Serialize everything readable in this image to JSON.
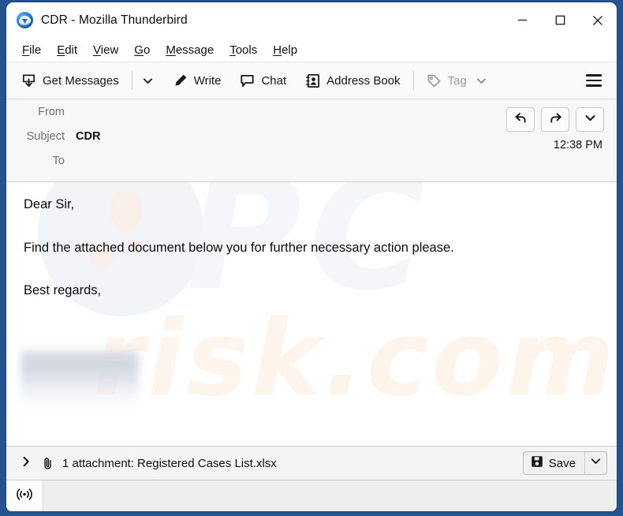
{
  "window": {
    "title": "CDR - Mozilla Thunderbird",
    "app_icon": "thunderbird-icon",
    "controls": {
      "minimize": "minimize-icon",
      "maximize": "maximize-icon",
      "close": "close-icon"
    }
  },
  "menubar": {
    "items": [
      {
        "label": "File",
        "accel": "F"
      },
      {
        "label": "Edit",
        "accel": "E"
      },
      {
        "label": "View",
        "accel": "V"
      },
      {
        "label": "Go",
        "accel": "G"
      },
      {
        "label": "Message",
        "accel": "M"
      },
      {
        "label": "Tools",
        "accel": "T"
      },
      {
        "label": "Help",
        "accel": "H"
      }
    ]
  },
  "toolbar": {
    "get_messages_label": "Get Messages",
    "get_messages_icon": "inbox-download-icon",
    "get_messages_caret": "chevron-down-icon",
    "write_label": "Write",
    "write_icon": "pencil-icon",
    "chat_label": "Chat",
    "chat_icon": "speech-bubble-icon",
    "address_book_label": "Address Book",
    "address_book_icon": "address-book-icon",
    "tag_label": "Tag",
    "tag_icon": "tag-icon",
    "tag_caret": "chevron-down-icon",
    "tag_disabled": true,
    "app_menu_icon": "hamburger-menu-icon"
  },
  "message_header": {
    "from_label": "From",
    "from_value": "",
    "subject_label": "Subject",
    "subject_value": "CDR",
    "to_label": "To",
    "to_value": "",
    "time": "12:38 PM",
    "actions": {
      "reply": "reply-arrow-icon",
      "forward": "forward-arrow-icon",
      "more": "chevron-down-icon"
    }
  },
  "message_body": {
    "lines": [
      "Dear Sir,",
      "Find the attached document below you for further necessary action please.",
      "Best regards,"
    ],
    "signature_redacted": true,
    "watermark_primary": "PC",
    "watermark_secondary": "risk.com"
  },
  "attachment_bar": {
    "expand_icon": "chevron-right-icon",
    "clip_icon": "paperclip-icon",
    "text": "1 attachment: Registered Cases List.xlsx",
    "count": 1,
    "filename": "Registered Cases List.xlsx",
    "save_label": "Save",
    "save_icon": "floppy-disk-icon",
    "save_caret": "chevron-down-icon"
  },
  "statusbar": {
    "connection_icon": "broadcast-signal-icon",
    "text": ""
  },
  "colors": {
    "desktop_blue": "#235390",
    "toolbar_bg": "#fafafa",
    "header_bg": "#f7f7f7",
    "body_bg": "#ffffff",
    "attachment_bg": "#f4f4f4",
    "status_bg": "#eeeeee",
    "text": "#101010",
    "muted_text": "#707070",
    "disabled_text": "#9a9a9a"
  }
}
